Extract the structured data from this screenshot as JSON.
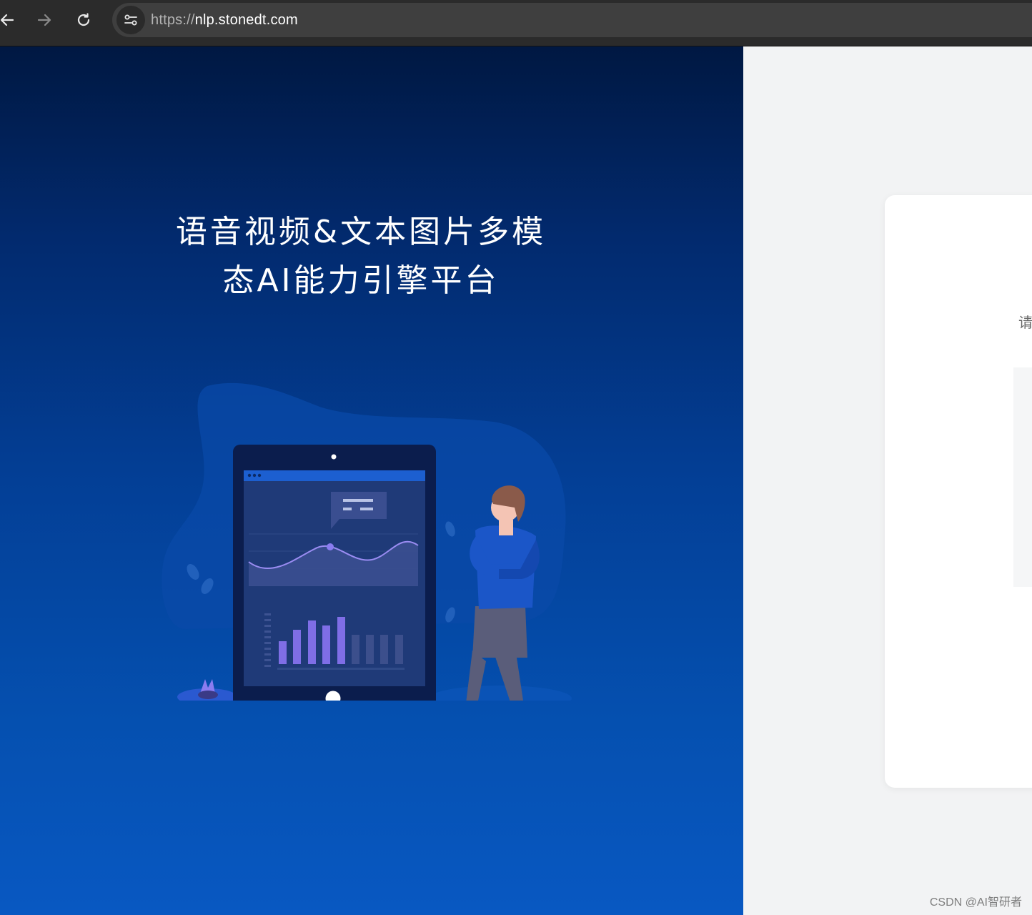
{
  "browser": {
    "url_scheme": "https://",
    "url_host": "nlp.stonedt.com",
    "back_icon": "arrow-left-icon",
    "forward_icon": "arrow-right-icon",
    "reload_icon": "reload-icon",
    "site_info_icon": "tune-icon"
  },
  "hero": {
    "title_line1": "语音视频&文本图片多模",
    "title_line2": "态AI能力引擎平台"
  },
  "login": {
    "hint_text": "请"
  },
  "watermark": "CSDN @AI智研者",
  "colors": {
    "hero_top": "#001842",
    "hero_bottom": "#0858c2",
    "page_bg": "#f2f3f4",
    "toolbar_bg": "#2b2b2b"
  }
}
